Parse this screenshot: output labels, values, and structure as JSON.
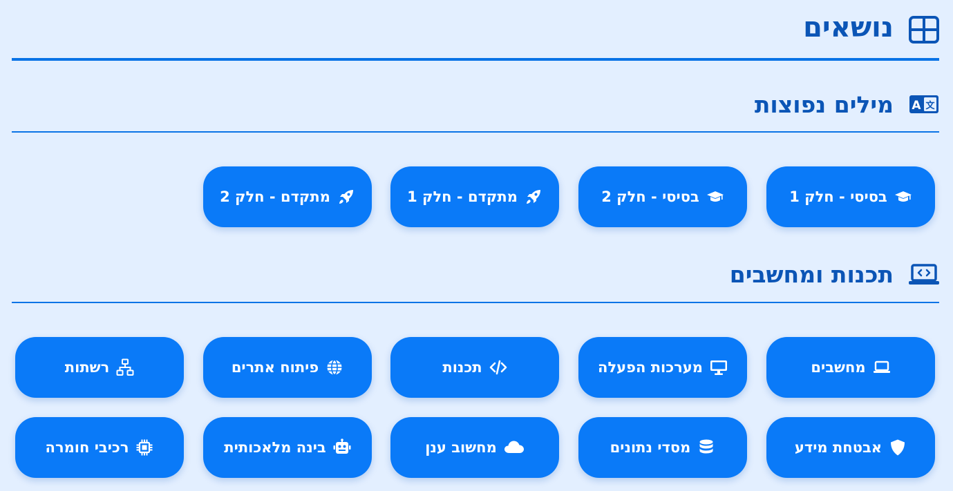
{
  "header": {
    "title": "נושאים",
    "icon": "grid-icon"
  },
  "sections": [
    {
      "title": "מילים נפוצות",
      "icon": "translate-icon",
      "buttons": [
        {
          "label": "בסיסי - חלק 1",
          "icon": "graduation-cap-icon"
        },
        {
          "label": "בסיסי - חלק 2",
          "icon": "graduation-cap-icon"
        },
        {
          "label": "מתקדם - חלק 1",
          "icon": "rocket-icon"
        },
        {
          "label": "מתקדם - חלק 2",
          "icon": "rocket-icon"
        }
      ]
    },
    {
      "title": "תכנות ומחשבים",
      "icon": "laptop-code-icon",
      "buttons": [
        {
          "label": "מחשבים",
          "icon": "laptop-icon"
        },
        {
          "label": "מערכות הפעלה",
          "icon": "desktop-icon"
        },
        {
          "label": "תכנות",
          "icon": "code-icon"
        },
        {
          "label": "פיתוח אתרים",
          "icon": "globe-icon"
        },
        {
          "label": "רשתות",
          "icon": "network-icon"
        },
        {
          "label": "אבטחת מידע",
          "icon": "shield-icon"
        },
        {
          "label": "מסדי נתונים",
          "icon": "database-icon"
        },
        {
          "label": "מחשוב ענן",
          "icon": "cloud-icon"
        },
        {
          "label": "בינה מלאכותית",
          "icon": "robot-icon"
        },
        {
          "label": "רכיבי חומרה",
          "icon": "microchip-icon"
        }
      ]
    }
  ],
  "colors": {
    "background": "#e3efff",
    "button": "#0a7af8",
    "heading": "#0b55b6",
    "divider": "#0a73e6"
  }
}
